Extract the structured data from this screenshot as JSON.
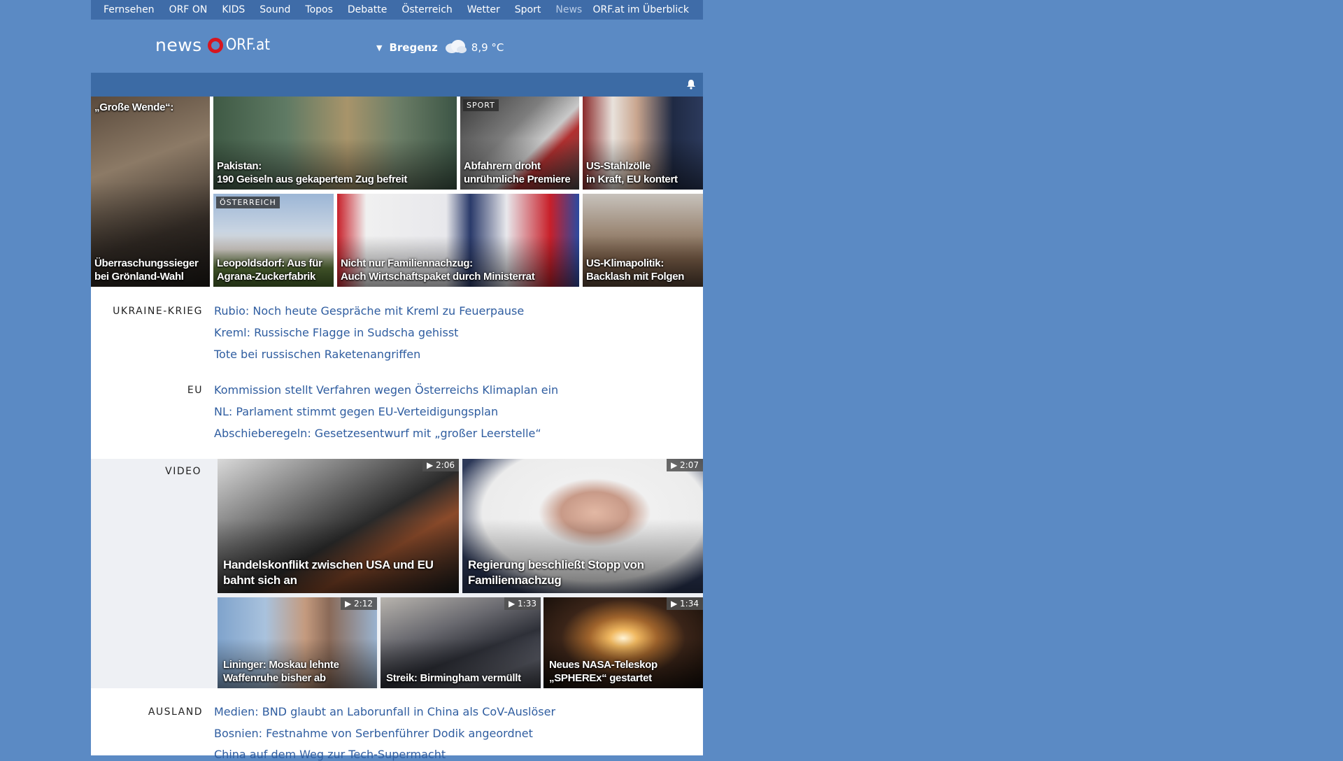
{
  "topnav": {
    "items": [
      "Fernsehen",
      "ORF ON",
      "KIDS",
      "Sound",
      "Topos",
      "Debatte",
      "Österreich",
      "Wetter",
      "Sport",
      "News"
    ],
    "right": "ORF.at im Überblick"
  },
  "header": {
    "logo_news": "news",
    "logo_orf": "ORF.at",
    "weather_location": "Bregenz",
    "weather_icon": "cloud-icon",
    "weather_temp": "8,9 °C"
  },
  "top_tiles": [
    {
      "caption_top": "„Große Wende“:",
      "caption": "Überraschungssieger bei Grönland-Wahl"
    },
    {
      "caption_line1": "Pakistan:",
      "caption_line2": "190 Geiseln aus gekapertem Zug befreit"
    },
    {
      "tag": "SPORT",
      "caption_line1": "Abfahrern droht",
      "caption_line2": "unrühmliche Premiere"
    },
    {
      "caption_line1": "US-Stahlzölle",
      "caption_line2": "in Kraft, EU kontert"
    },
    {
      "tag": "ÖSTERREICH",
      "caption_line1": "Leopoldsdorf: Aus für",
      "caption_line2": "Agrana-Zuckerfabrik"
    },
    {
      "caption_line1": "Nicht nur Familiennachzug:",
      "caption_line2": "Auch Wirtschaftspaket durch Ministerrat"
    },
    {
      "caption_line1": "US-Klimapolitik:",
      "caption_line2": "Backlash mit Folgen"
    }
  ],
  "sections": {
    "ukraine": {
      "label": "UKRAINE-KRIEG",
      "headlines": [
        "Rubio: Noch heute Gespräche mit Kreml zu Feuerpause",
        "Kreml: Russische Flagge in Sudscha gehisst",
        "Tote bei russischen Raketenangriffen"
      ]
    },
    "eu": {
      "label": "EU",
      "headlines": [
        "Kommission stellt Verfahren wegen Österreichs Klimaplan ein",
        "NL: Parlament stimmt gegen EU-Verteidigungsplan",
        "Abschieberegeln: Gesetzesentwurf mit „großer Leerstelle“"
      ]
    },
    "video": {
      "label": "VIDEO",
      "items": [
        {
          "duration": "2:06",
          "caption_line1": "Handelskonflikt zwischen USA und EU",
          "caption_line2": "bahnt sich an"
        },
        {
          "duration": "2:07",
          "caption_line1": "Regierung beschließt Stopp von",
          "caption_line2": "Familiennachzug"
        },
        {
          "duration": "2:12",
          "caption_line1": "Lininger: Moskau lehnte",
          "caption_line2": "Waffenruhe bisher ab"
        },
        {
          "duration": "1:33",
          "caption_line1": "Streik: Birmingham vermüllt"
        },
        {
          "duration": "1:34",
          "caption_line1": "Neues NASA-Teleskop",
          "caption_line2": "„SPHEREx“ gestartet"
        }
      ]
    },
    "ausland": {
      "label": "AUSLAND",
      "headlines": [
        "Medien: BND glaubt an Laborunfall in China als CoV-Auslöser",
        "Bosnien: Festnahme von Serbenführer Dodik angeordnet",
        "China auf dem Weg zur Tech-Supermacht"
      ]
    }
  },
  "colors": {
    "background": "#5b8ac4",
    "nav": "#3f6ca8",
    "link": "#2f5da0",
    "logo_red": "#d7151f"
  }
}
